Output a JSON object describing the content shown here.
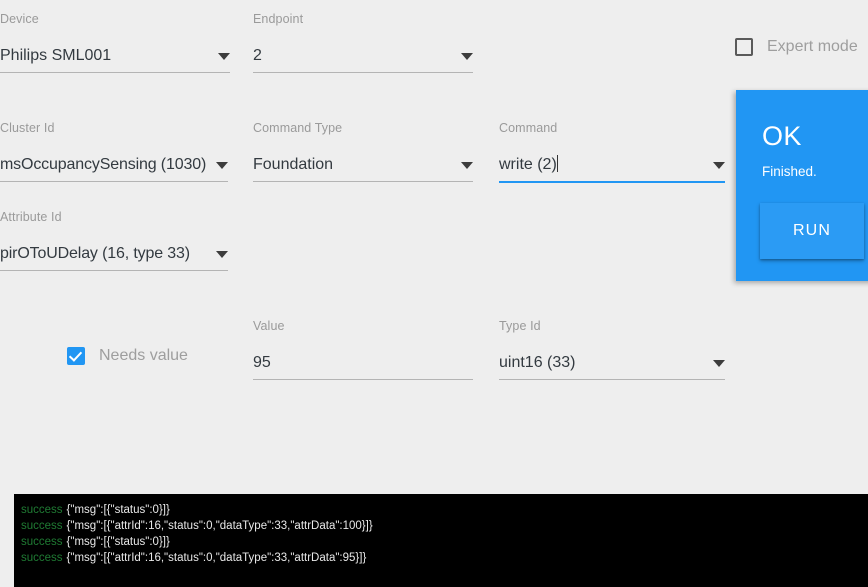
{
  "form": {
    "device": {
      "label": "Device",
      "value": "Philips SML001",
      "icon": "chevron-down-icon",
      "focused": false
    },
    "endpoint": {
      "label": "Endpoint",
      "value": "2",
      "icon": "chevron-down-icon",
      "focused": false
    },
    "cluster_id": {
      "label": "Cluster Id",
      "value": "msOccupancySensing (1030)",
      "icon": "chevron-down-icon",
      "focused": false
    },
    "command_type": {
      "label": "Command Type",
      "value": "Foundation",
      "icon": "chevron-down-icon",
      "focused": false
    },
    "command": {
      "label": "Command",
      "value": "write (2)",
      "icon": "chevron-down-icon",
      "focused": true
    },
    "attribute_id": {
      "label": "Attribute Id",
      "value": "pirOToUDelay (16, type 33)",
      "icon": "chevron-down-icon",
      "focused": false
    },
    "value_field": {
      "label": "Value",
      "value": "95",
      "focused": false
    },
    "type_id": {
      "label": "Type Id",
      "value": "uint16 (33)",
      "icon": "chevron-down-icon",
      "focused": false
    },
    "expert_mode": {
      "label": "Expert mode",
      "checked": false
    },
    "needs_value": {
      "label": "Needs value",
      "checked": true
    }
  },
  "status_panel": {
    "title": "OK",
    "subtitle": "Finished.",
    "run_label": "RUN",
    "accent_color": "#2196f3",
    "button_color": "#2b9bf4"
  },
  "console": {
    "background": "#000000",
    "level_color": "#1f7a33",
    "text_color": "#e8e8e8",
    "lines": [
      {
        "level": "success",
        "message": "{\"msg\":[{\"status\":0}]}"
      },
      {
        "level": "success",
        "message": "{\"msg\":[{\"attrId\":16,\"status\":0,\"dataType\":33,\"attrData\":100}]}"
      },
      {
        "level": "success",
        "message": "{\"msg\":[{\"status\":0}]}"
      },
      {
        "level": "success",
        "message": "{\"msg\":[{\"attrId\":16,\"status\":0,\"dataType\":33,\"attrData\":95}]}"
      }
    ]
  }
}
